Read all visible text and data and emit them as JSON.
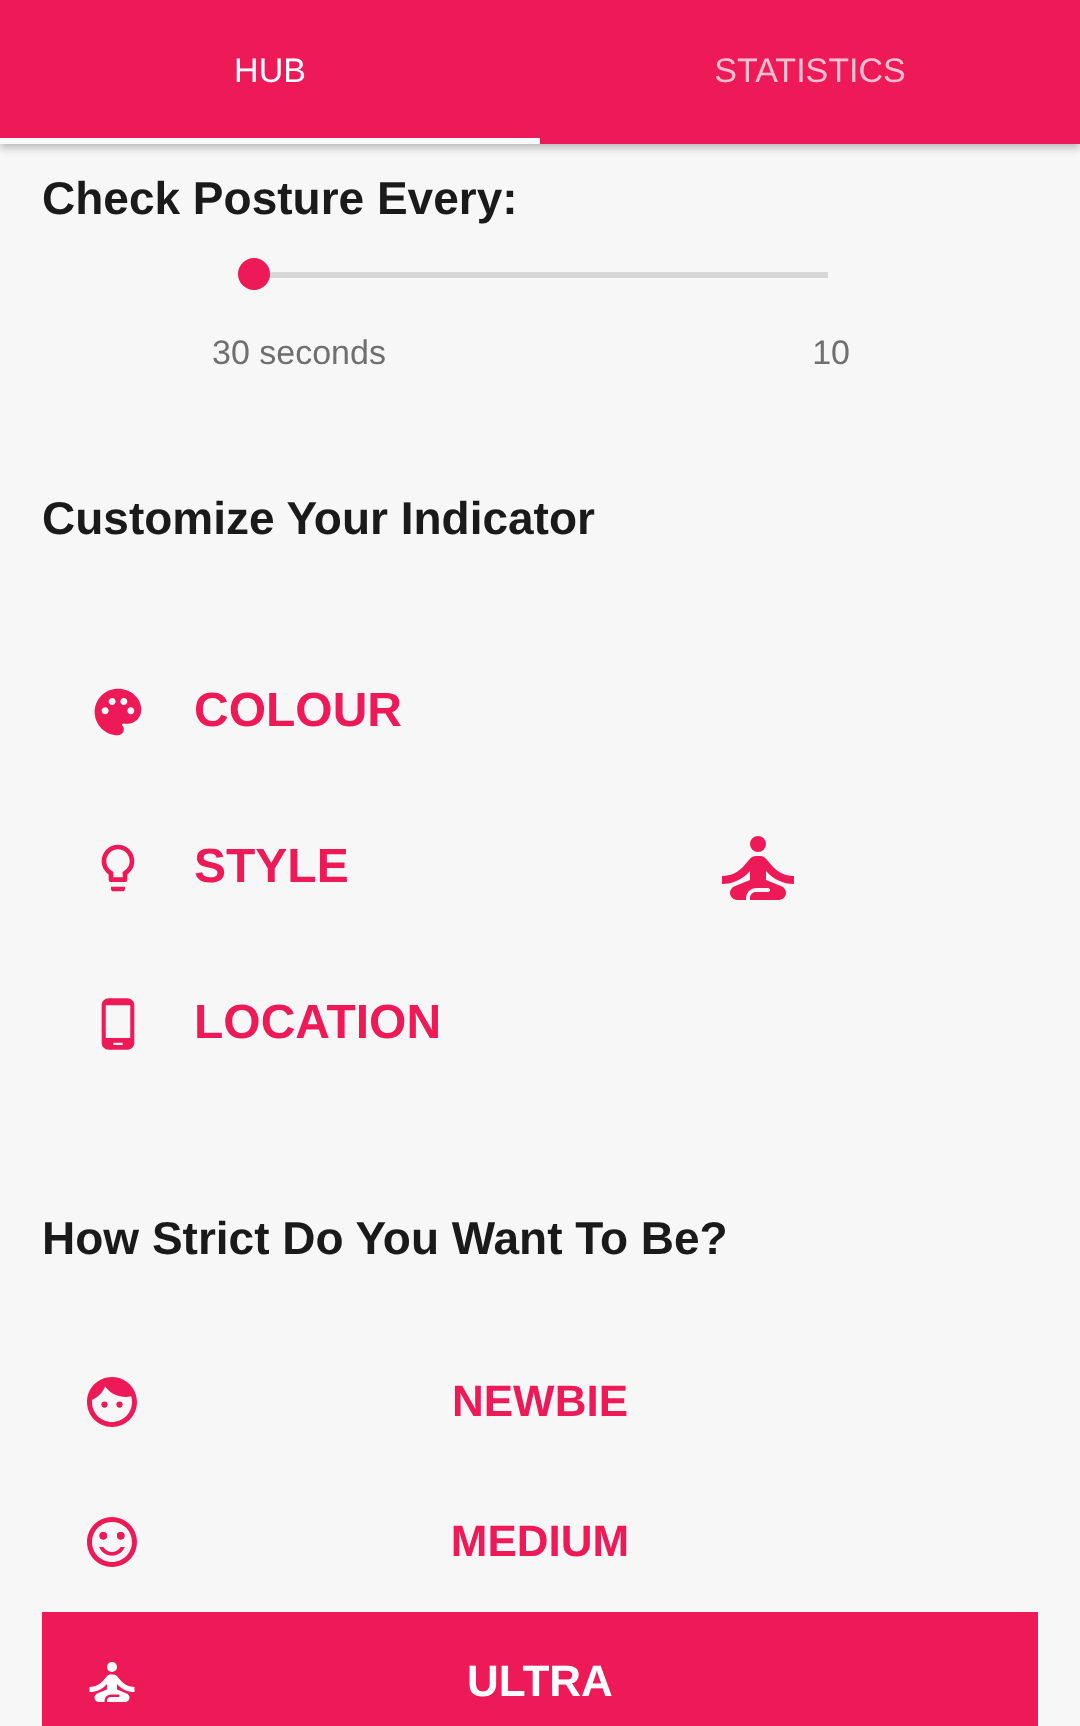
{
  "tabs": [
    {
      "label": "HUB",
      "selected": true
    },
    {
      "label": "STATISTICS",
      "selected": false
    }
  ],
  "posture": {
    "heading": "Check Posture Every:",
    "slider": {
      "level": 0
    },
    "min_label": "30 seconds",
    "max_label": "10"
  },
  "indicator": {
    "heading": "Customize Your Indicator",
    "options": [
      {
        "label": "COLOUR"
      },
      {
        "label": "STYLE"
      },
      {
        "label": "LOCATION"
      }
    ]
  },
  "strictness": {
    "heading": "How Strict Do You Want To Be?",
    "levels": [
      {
        "label": "NEWBIE",
        "selected": false
      },
      {
        "label": "MEDIUM",
        "selected": false
      },
      {
        "label": "ULTRA",
        "selected": true
      }
    ]
  }
}
